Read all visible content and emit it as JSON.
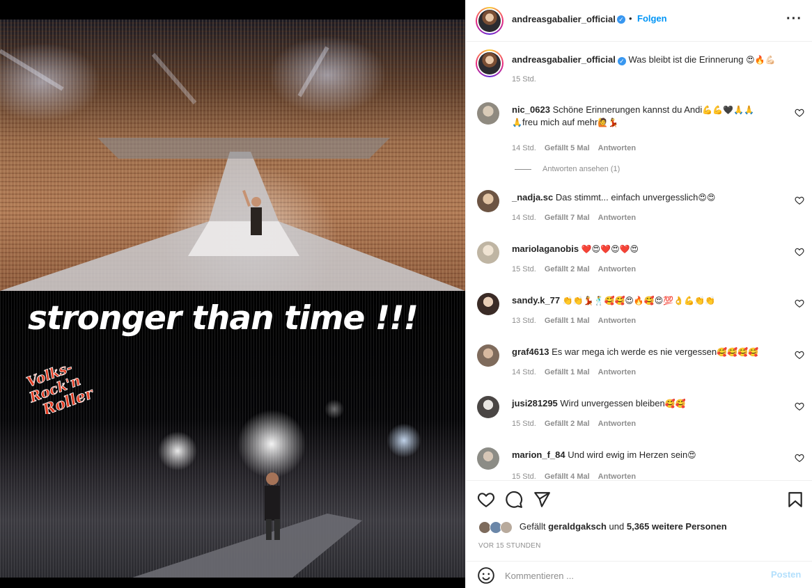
{
  "post": {
    "headline": "stronger than time !!!",
    "logo_text": [
      "Volks-",
      "Rock'n",
      "Roller"
    ]
  },
  "header": {
    "username": "andreasgabalier_official",
    "dot": "•",
    "follow_label": "Folgen",
    "more_icon": "more-horizontal-icon"
  },
  "caption": {
    "username": "andreasgabalier_official",
    "text": "Was bleibt ist die Erinnerung",
    "emoji": "😍🔥💪🏻",
    "time": "15 Std."
  },
  "comments": [
    {
      "username": "nic_0623",
      "text": "Schöne Erinnerungen kannst du Andi",
      "emoji": "💪💪🖤🙏🙏",
      "text2": "freu mich auf mehr",
      "emoji2": "🙏",
      "emoji3": "🙋💃",
      "time": "14 Std.",
      "likes": "Gefällt 5 Mal",
      "reply": "Antworten",
      "view_replies": "Antworten ansehen (1)"
    },
    {
      "username": "_nadja.sc",
      "text": "Das stimmt... einfach unvergesslich",
      "emoji": "😍😍",
      "time": "14 Std.",
      "likes": "Gefällt 7 Mal",
      "reply": "Antworten"
    },
    {
      "username": "mariolaganobis",
      "text": "",
      "emoji": "❤️😍❤️😍❤️😍",
      "time": "15 Std.",
      "likes": "Gefällt 2 Mal",
      "reply": "Antworten"
    },
    {
      "username": "sandy.k_77",
      "text": "",
      "emoji": "👏👏💃🕺🥰🥰😍🔥🥰😍💯👌💪👏👏",
      "time": "13 Std.",
      "likes": "Gefällt 1 Mal",
      "reply": "Antworten"
    },
    {
      "username": "graf4613",
      "text": "Es war mega ich werde es nie vergessen",
      "emoji": "🥰🥰🥰🥰",
      "time": "14 Std.",
      "likes": "Gefällt 1 Mal",
      "reply": "Antworten"
    },
    {
      "username": "jusi281295",
      "text": "Wird unvergessen bleiben",
      "emoji": "🥰🥰",
      "time": "15 Std.",
      "likes": "Gefällt 2 Mal",
      "reply": "Antworten"
    },
    {
      "username": "marion_f_84",
      "text": "Und wird ewig im Herzen sein",
      "emoji": "😍",
      "time": "15 Std.",
      "likes": "Gefällt 4 Mal",
      "reply": "Antworten"
    }
  ],
  "actions": {
    "like_icon": "heart-icon",
    "comment_icon": "comment-icon",
    "share_icon": "paper-plane-icon",
    "save_icon": "bookmark-icon"
  },
  "likes": {
    "prefix": "Gefällt",
    "user": "geraldgaksch",
    "middle": "und",
    "others": "5,365 weitere Personen"
  },
  "posted_ago": "VOR 15 STUNDEN",
  "compose": {
    "placeholder": "Kommentieren ...",
    "post_label": "Posten"
  },
  "colors": {
    "accent": "#0095f6",
    "verified": "#3897f0",
    "muted": "#8e8e8e",
    "post_disabled": "#b2dffc"
  }
}
